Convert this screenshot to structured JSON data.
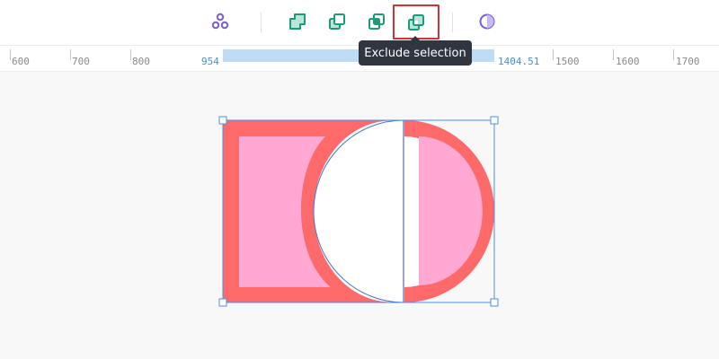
{
  "toolbar": {
    "buttons": [
      {
        "name": "group-icon",
        "color": "#7a5ecf"
      },
      {
        "name": "union-icon",
        "color": "#1c9a7a"
      },
      {
        "name": "subtract-icon",
        "color": "#1c9a7a"
      },
      {
        "name": "intersect-icon",
        "color": "#1c9a7a"
      },
      {
        "name": "exclude-icon",
        "color": "#1c9a7a",
        "active": true
      },
      {
        "name": "flatten-icon",
        "color": "#7a5ecf"
      }
    ]
  },
  "tooltip": {
    "text": "Exclude selection"
  },
  "ruler": {
    "labels": [
      "600",
      "700",
      "800",
      "1500",
      "1600",
      "1700"
    ],
    "selection_start": "954",
    "selection_end": "1404.51"
  },
  "colors": {
    "shape_fill": "#fe6a6a",
    "hole_fill": "#ffffff",
    "inner_fill": "#ffa8d4",
    "selection": "#4a90e2"
  }
}
